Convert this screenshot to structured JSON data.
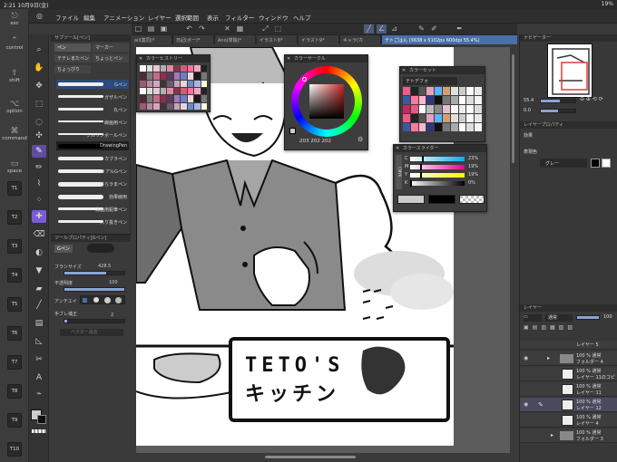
{
  "status": {
    "time_date": "2:21  10月9日(金)",
    "battery": "19%"
  },
  "menu": [
    "ファイル",
    "編集",
    "アニメーション",
    "レイヤー",
    "選択範囲",
    "表示",
    "フィルター",
    "ウィンドウ",
    "ヘルプ"
  ],
  "tabs": [
    "ail(案同)*",
    "日記(ボー)*",
    "Ano(単独)*",
    "イラスト8*",
    "イラスト9*",
    "キャラ(カ",
    "テトごはん (3638 x 5102px 600dpi 55.4%)"
  ],
  "left_rail": {
    "esc": "esc",
    "control": "control",
    "shift": "shift",
    "option": "option",
    "command": "command",
    "space": "space",
    "keys": [
      "T1",
      "T2",
      "T3",
      "T4",
      "T5",
      "T6",
      "T7",
      "T8",
      "T9",
      "T10"
    ]
  },
  "subtool": {
    "header": "サブツール[ペン]",
    "tab_pen": "ペン",
    "tab_marker": "マーカー",
    "btn1": "テテレまたペン",
    "btn2": "ちょっとペン",
    "btn3": "ちょっぴり",
    "brushes": [
      "Gペン",
      "ガザルペン",
      "丸ペン",
      "線画用ペン",
      "グルリンボールペン",
      "DrawingPen",
      "カブラペン",
      "リアルGペン",
      "ぼらラまペン",
      "効果線用",
      "線画用鉛筆ペン",
      "入り抜きペン"
    ]
  },
  "toolprop": {
    "header": "ツールプロパティ[Gペン]",
    "name": "Gペン",
    "size_label": "ブラシサイズ",
    "size_value": "428.5",
    "opacity_label": "不透明度",
    "opacity_value": "100",
    "opacity_level": 1.0,
    "antialias_label": "アンチエイ",
    "stabilizer_label": "手ブレ補正",
    "stabilizer_value": "2",
    "vector_label": "ベクター消去"
  },
  "palettes": {
    "color_set_left": "カラーヒストリー",
    "color_circle": "カラーサークル",
    "rgb": "203  202  202",
    "color_set": "カラーセット",
    "color_set_name": "テトデフォ",
    "sliders": "カラースライダー",
    "cmyk_labels": [
      "C",
      "M",
      "Y",
      "K"
    ],
    "cmyk_values": [
      "23%",
      "19%",
      "19%",
      "0%"
    ],
    "cmyk_levels": [
      0.23,
      0.19,
      0.19,
      0.0
    ]
  },
  "canvas_text": {
    "line1": "TETO'S",
    "line2": "キッチン"
  },
  "right": {
    "navigator": "ナビゲーター",
    "nav_val1": "55.4",
    "nav_val2": "0.0",
    "layerprop": "レイヤープロパティ",
    "effect": "効果",
    "display_color": "表現色",
    "display_value": "グレー",
    "layers_header": "レイヤー",
    "blend": "通常",
    "opacity": "100",
    "layers": [
      {
        "l1": "レイヤー 5",
        "l2": ""
      },
      {
        "l1": "100 % 通常",
        "l2": "フォルダー 4"
      },
      {
        "l1": "100 % 通常",
        "l2": "レイヤー 11のコピー"
      },
      {
        "l1": "100 % 通常",
        "l2": "レイヤー 11"
      },
      {
        "l1": "100 % 通常",
        "l2": "レイヤー 12"
      },
      {
        "l1": "100 % 通常",
        "l2": "レイヤー 4"
      },
      {
        "l1": "100 % 通常",
        "l2": "フォルダー 3"
      }
    ]
  },
  "colors": {
    "accent": "#4a6ea8",
    "selected_tool": "#5d4e9e"
  }
}
